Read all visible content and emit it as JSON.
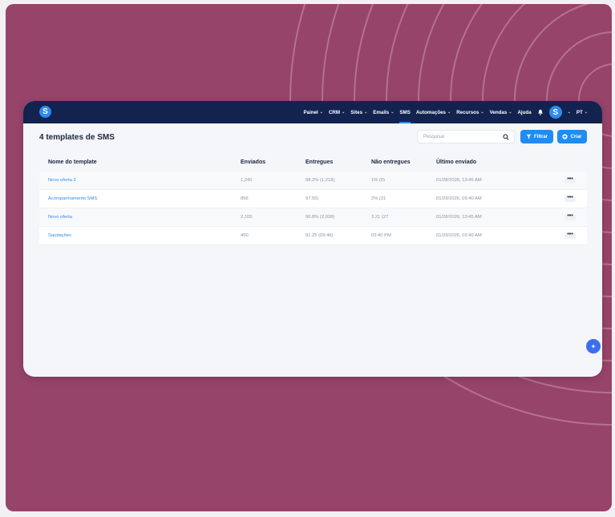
{
  "nav": {
    "items": [
      {
        "label": "Painel",
        "has_chevron": true
      },
      {
        "label": "CRM",
        "has_chevron": true
      },
      {
        "label": "Sites",
        "has_chevron": true
      },
      {
        "label": "Emails",
        "has_chevron": true
      },
      {
        "label": "SMS",
        "has_chevron": false,
        "active": true
      },
      {
        "label": "Automações",
        "has_chevron": true
      },
      {
        "label": "Recursos",
        "has_chevron": true
      },
      {
        "label": "Vendas",
        "has_chevron": true
      },
      {
        "label": "Ajuda",
        "has_chevron": false
      }
    ],
    "logo_letter": "S",
    "avatar_letter": "S",
    "language": "PT"
  },
  "page": {
    "title": "4 templates de SMS",
    "search_placeholder": "Pesquisar",
    "filter_label": "Filtrar",
    "create_label": "Criar"
  },
  "table": {
    "headers": [
      "Nome do template",
      "Enviados",
      "Entregues",
      "Não entregues",
      "Último enviado"
    ],
    "rows": [
      {
        "name": "Novo oferta 2",
        "sent": "1,240",
        "delivered": "98.2% (1,218)",
        "undelivered": "1% (0)",
        "last": "01/28/2026, 13:45 AM"
      },
      {
        "name": "Acompanhamento SMS",
        "sent": "856",
        "delivered": "97.55)",
        "undelivered": "2% (21",
        "last": "01/29/2026, 09:40 AM"
      },
      {
        "name": "Novo oferta",
        "sent": "2,105",
        "delivered": "96.8% (2,038)",
        "undelivered": "3.21 (27",
        "last": "01/28/2026, 13:45 AM"
      },
      {
        "name": "Saudações",
        "sent": "450",
        "delivered": "91.25 (09:46)",
        "undelivered": "03:40 PM",
        "last": "01/29/2026, 03:40 AM"
      }
    ],
    "more_symbol": "•••"
  },
  "colors": {
    "background": "#97446a",
    "nav": "#12234f",
    "accent": "#1f8cf0"
  },
  "icons": [
    "search-icon",
    "filter-icon",
    "plus-circle-icon",
    "bell-icon",
    "sparkle-icon"
  ]
}
